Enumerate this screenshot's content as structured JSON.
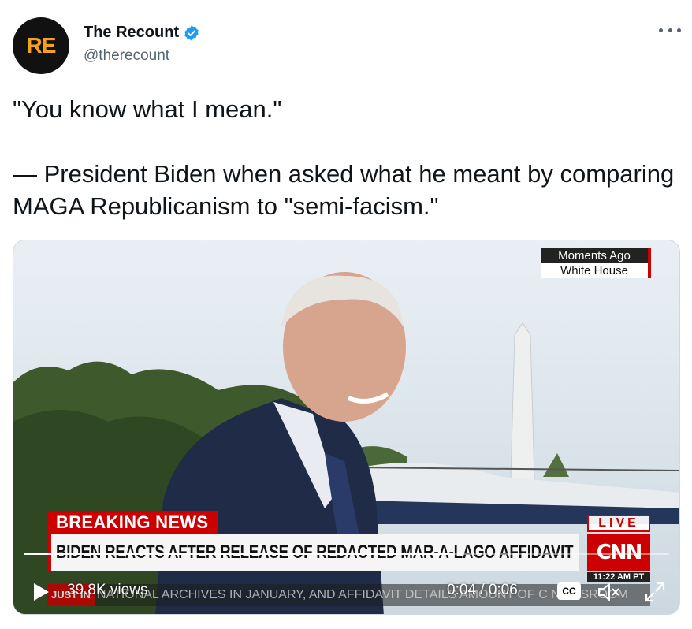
{
  "account": {
    "display_name": "The Recount",
    "handle": "@therecount",
    "avatar_text": "RE",
    "verified": true
  },
  "tweet": {
    "line1": "\"You know what I mean.\"",
    "line2": "— President Biden when asked what he meant by comparing MAGA Republicanism to \"semi-facism.\""
  },
  "video": {
    "overlay": {
      "corner_top": "Moments Ago",
      "corner_bottom": "White House",
      "breaking": "BREAKING NEWS",
      "headline": "BIDEN REACTS AFTER RELEASE OF REDACTED MAR-A-LAGO AFFIDAVIT",
      "live": "LIVE",
      "network": "CNN",
      "clock": "11:22 AM PT",
      "ticker_label": "JUST IN",
      "ticker": "NATIONAL ARCHIVES IN JANUARY, AND AFFIDAVIT DETAILS AMOUNT OF C NEWSROOM"
    },
    "views": "39.8K views",
    "time": "0:04 / 0:06",
    "progress": 0.6667,
    "cc_label": "CC"
  },
  "colors": {
    "accent": "#1d9bf0",
    "cnn_red": "#cc0000",
    "brand_orange": "#f4a11c"
  },
  "icons": {
    "verified": "verified-badge-icon",
    "more": "more-dots-icon",
    "play": "play-icon",
    "mute": "muted-speaker-icon",
    "fullscreen": "fullscreen-icon"
  }
}
